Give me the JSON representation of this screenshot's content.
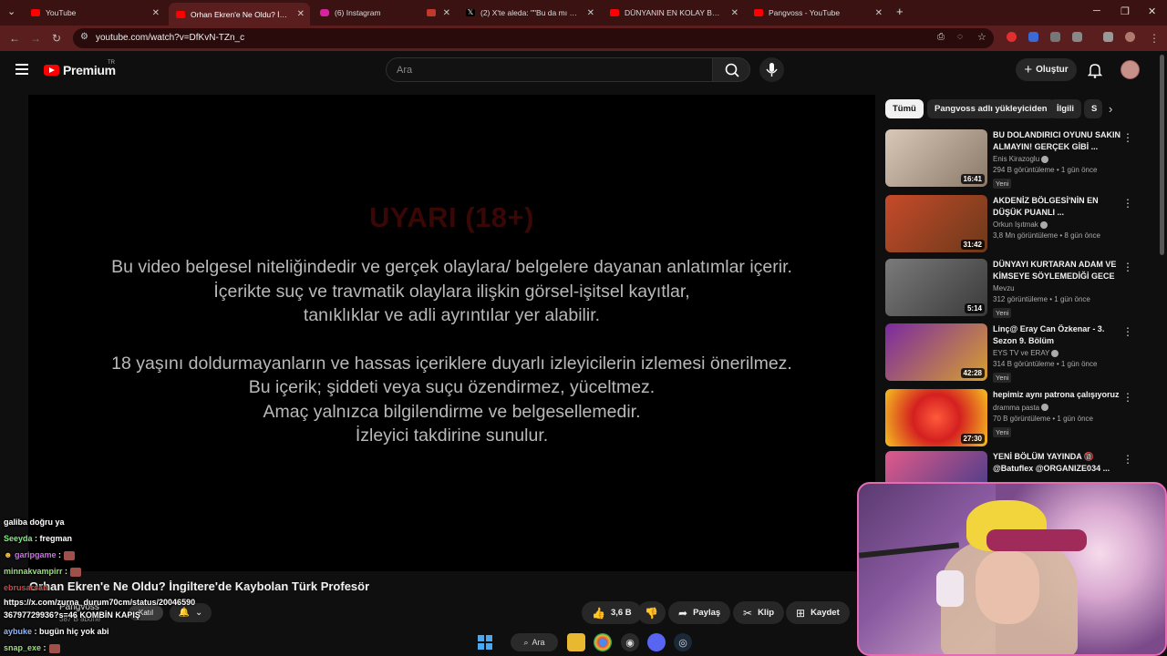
{
  "browser": {
    "tabs": [
      {
        "label": "YouTube",
        "favicon_color": "#ff0000"
      },
      {
        "label": "Orhan Ekren'e Ne Oldu? İngilter",
        "favicon_color": "#ff0000"
      },
      {
        "label": "(6) Instagram",
        "favicon_color": "#d6249f"
      },
      {
        "label": "",
        "favicon_color": "#c0392b"
      },
      {
        "label": "(2) X'te aleda: \"\"Bu da mı Cema",
        "favicon_color": "#000000"
      },
      {
        "label": "DÜNYANIN EN KOLAY BANKA S",
        "favicon_color": "#ff0000"
      },
      {
        "label": "Pangvoss - YouTube",
        "favicon_color": "#ff0000"
      }
    ],
    "new_tab": "+",
    "url": "youtube.com/watch?v=DfKvN-TZn_c"
  },
  "header": {
    "logo_text": "Premium",
    "region": "TR",
    "search_placeholder": "Ara",
    "create_label": "Oluştur"
  },
  "player": {
    "warning_title": "UYARI (18+)",
    "warning_lines": [
      "Bu video belgesel niteliğindedir ve gerçek olaylara/ belgelere dayanan anlatımlar içerir.",
      "İçerikte suç ve travmatik olaylara ilişkin görsel-işitsel kayıtlar,",
      "tanıklıklar ve adli ayrıntılar yer alabilir.",
      "18 yaşını doldurmayanların ve hassas içeriklere duyarlı izleyicilerin izlemesi önerilmez.",
      "Bu içerik; şiddeti veya suçu özendirmez, yüceltmez.",
      "Amaç yalnızca bilgilendirme ve belgesellemedir.",
      "İzleyici takdirine sunulur."
    ]
  },
  "chips": [
    "Tümü",
    "Pangvoss adlı yükleyiciden",
    "İlgili",
    "S"
  ],
  "recommendations": [
    {
      "title": "BU DOLANDIRICI OYUNU SAKIN ALMAYIN! GERÇEK GİBİ ...",
      "channel": "Enis Kirazoglu",
      "meta": "294 B görüntüleme • 1 gün önce",
      "badge": "Yeni",
      "duration": "16:41",
      "thumb_color": "#c9b7a8"
    },
    {
      "title": "AKDENİZ BÖLGESİ'NİN EN DÜŞÜK PUANLI ...",
      "channel": "Orkun Işıtmak",
      "meta": "3,8 Mn görüntüleme • 8 gün önce",
      "badge": "",
      "duration": "31:42",
      "thumb_color": "#8a5a3a"
    },
    {
      "title": "DÜNYAYI KURTARAN ADAM VE KİMSEYE SÖYLEMEDİĞİ GECE",
      "channel": "Mevzu",
      "meta": "312 görüntüleme • 1 gün önce",
      "badge": "Yeni",
      "duration": "5:14",
      "thumb_color": "#5e5e5e"
    },
    {
      "title": "Linç@ Eray Can Özkenar - 3. Sezon 9. Bölüm",
      "channel": "EYS TV ve ERAY",
      "meta": "314 B görüntüleme • 1 gün önce",
      "badge": "Yeni",
      "duration": "42:28",
      "thumb_color": "#6a2d8a"
    },
    {
      "title": "hepimiz aynı patrona çalışıyoruz",
      "channel": "dramma pasta",
      "meta": "70 B görüntüleme • 1 gün önce",
      "badge": "Yeni",
      "duration": "27:30",
      "thumb_color": "#d42a2a"
    },
    {
      "title": "YENİ BÖLÜM YAYINDA 🔞 @Batuflex @ORGANIZE034 ...",
      "channel": "",
      "meta": "",
      "badge": "",
      "duration": "",
      "thumb_color": "#c44a7a"
    }
  ],
  "video": {
    "title": "Orhan Ekren'e Ne Oldu? İngiltere'de Kaybolan Türk Profesör",
    "channel": "Pangvoss",
    "subscribers": "387 B abone",
    "join": "Katıl",
    "likes": "3,6 B",
    "share": "Paylaş",
    "clip": "Klip",
    "save": "Kaydet"
  },
  "chat": [
    {
      "user": "",
      "text": "galiba doğru ya"
    },
    {
      "user": "Seeyda",
      "text": ": fregman"
    },
    {
      "user": "garipgame",
      "text": ":"
    },
    {
      "user": "minnakvampirr",
      "text": ":"
    },
    {
      "user": "ebrusarsan",
      "text": ""
    },
    {
      "user": "",
      "text": "https://x.com/zurna_durum70cm/status/20046590"
    },
    {
      "user": "",
      "text": "36797729936?s=46 KOMBİN KAPIŞ"
    },
    {
      "user": "aybuke",
      "text": ": bugün hiç yok abi"
    },
    {
      "user": "snap_exe",
      "text": ":"
    }
  ],
  "taskbar": {
    "search_label": "Ara"
  }
}
